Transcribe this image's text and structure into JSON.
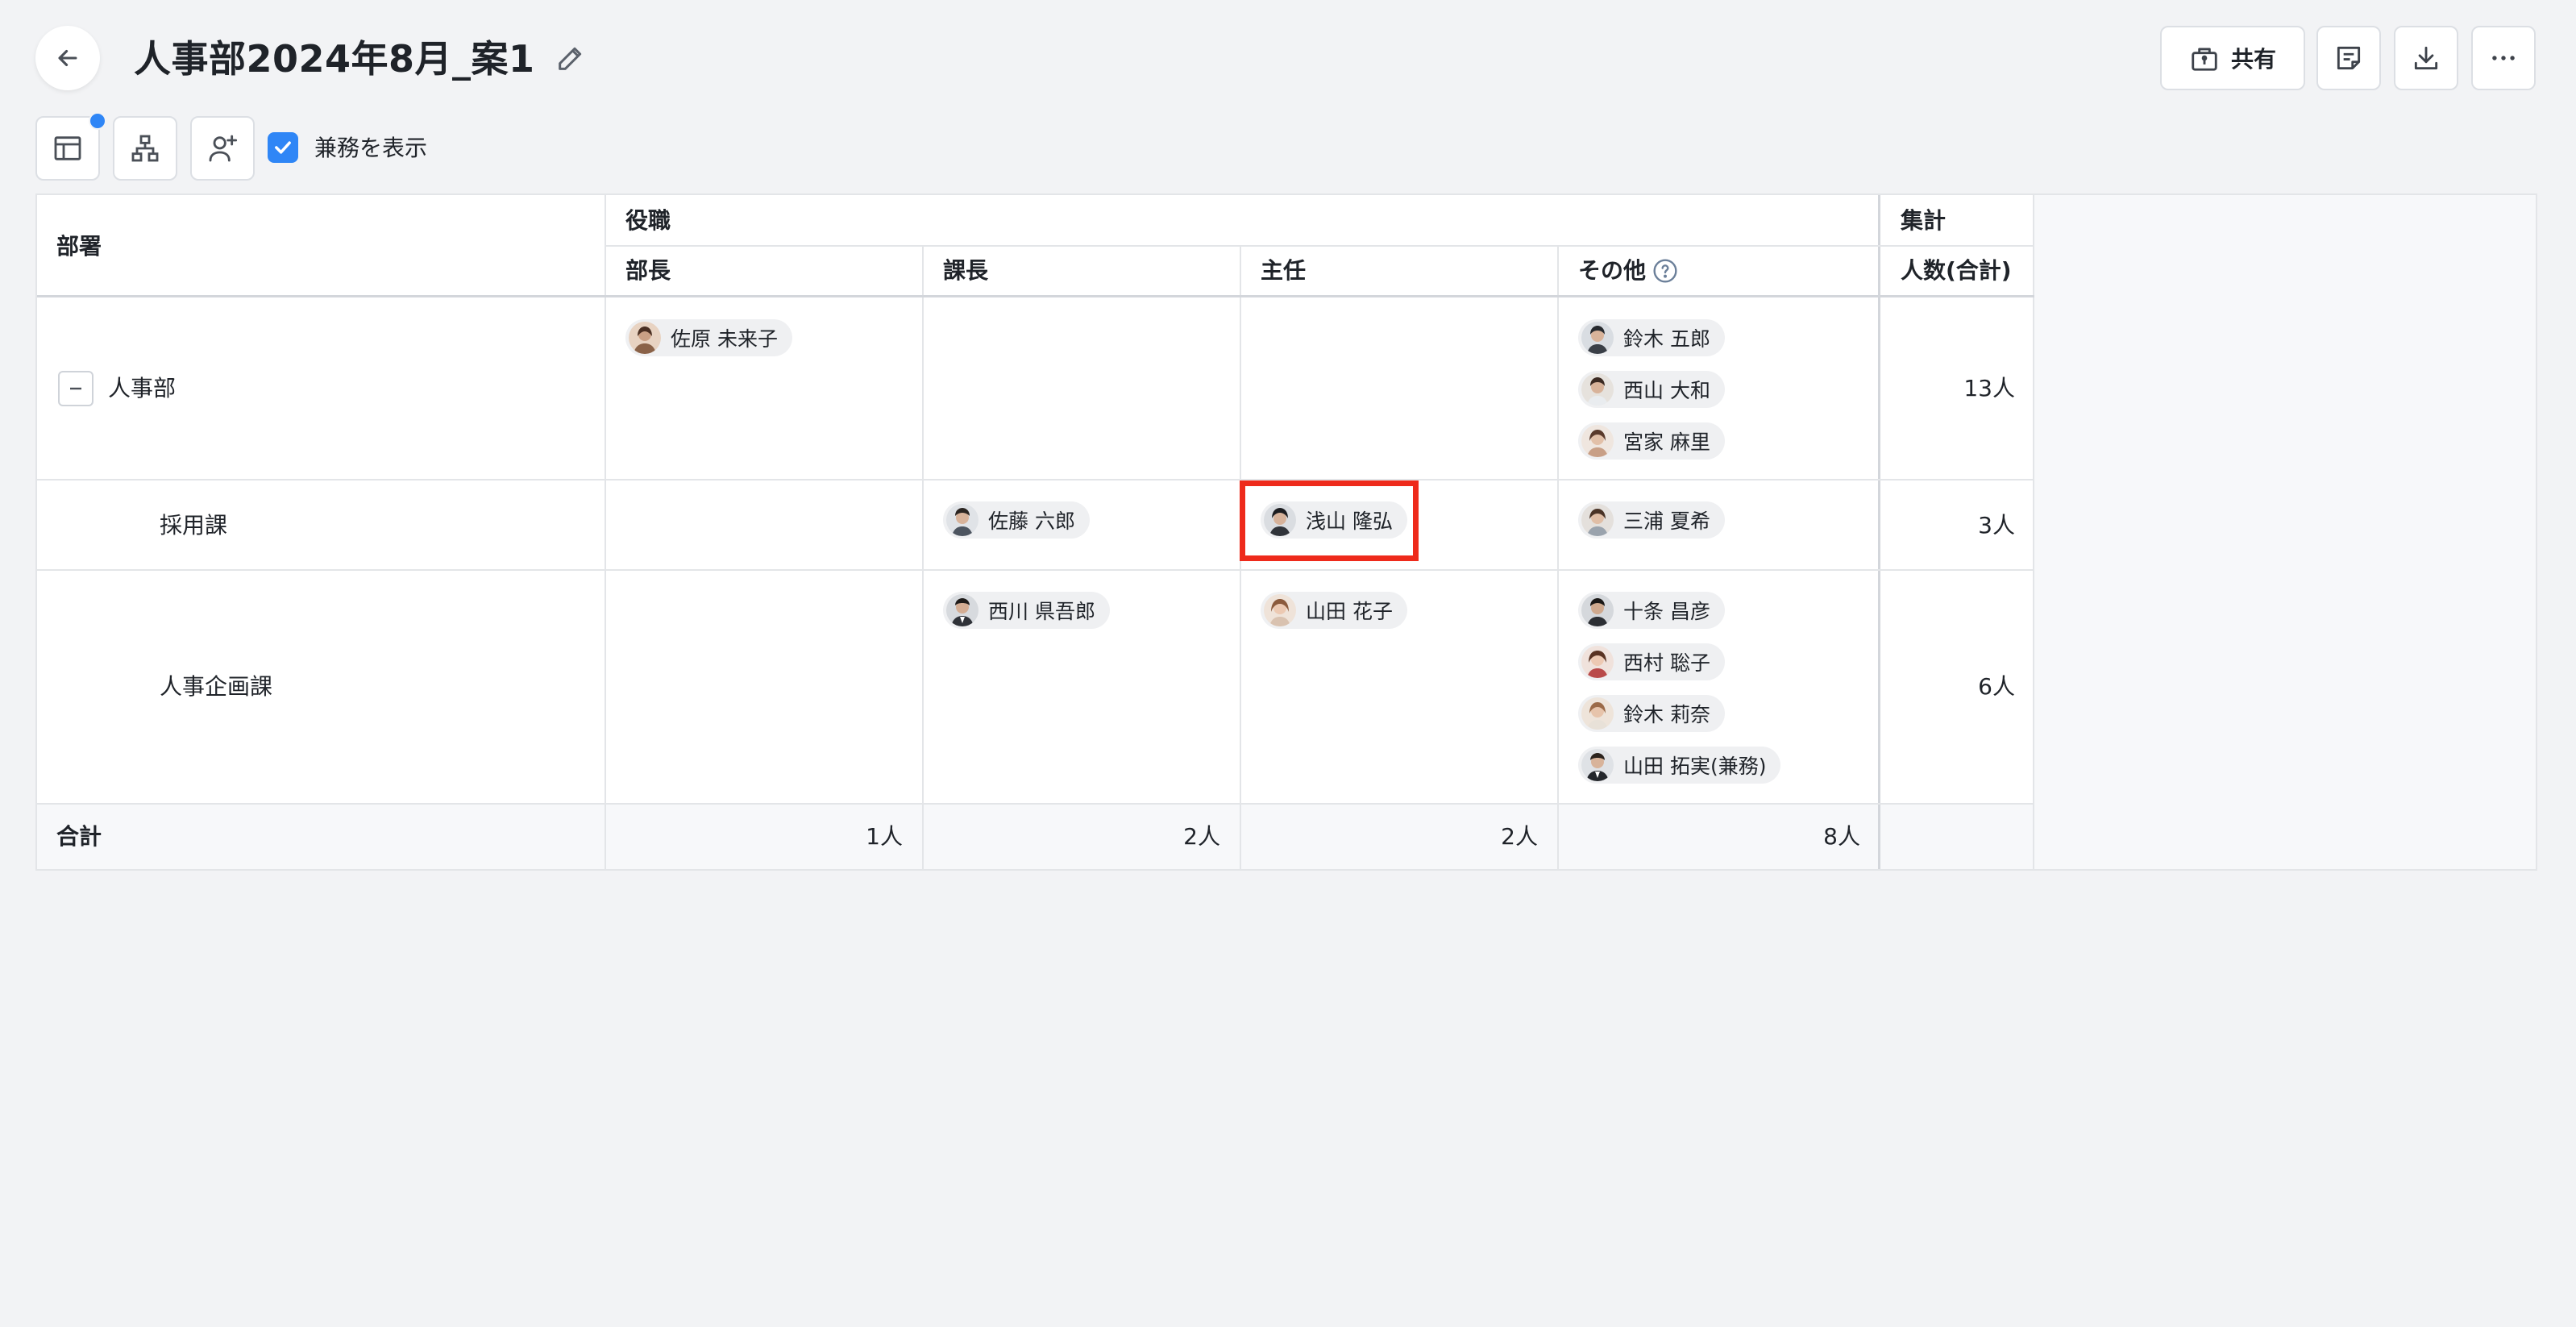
{
  "header": {
    "title": "人事部2024年8月_案1",
    "share_label": "共有"
  },
  "toolbar": {
    "show_concurrent_label": "兼務を表示",
    "show_concurrent_checked": true
  },
  "table": {
    "col_department": "部署",
    "group_positions": "役職",
    "group_summary": "集計",
    "col_bucho": "部長",
    "col_kacho": "課長",
    "col_shunin": "主任",
    "col_other": "その他",
    "col_count": "人数(合計)",
    "rows": [
      {
        "dept": "人事部",
        "bucho": [
          "佐原 未来子"
        ],
        "kacho": [],
        "shunin": [],
        "other": [
          "鈴木 五郎",
          "西山 大和",
          "宮家 麻里"
        ],
        "count": "13人"
      },
      {
        "dept": "採用課",
        "bucho": [],
        "kacho": [
          "佐藤 六郎"
        ],
        "shunin": [
          "浅山 隆弘"
        ],
        "other": [
          "三浦 夏希"
        ],
        "count": "3人"
      },
      {
        "dept": "人事企画課",
        "bucho": [],
        "kacho": [
          "西川 県吾郎"
        ],
        "shunin": [
          "山田 花子"
        ],
        "other": [
          "十条 昌彦",
          "西村 聡子",
          "鈴木 莉奈",
          "山田 拓実(兼務)"
        ],
        "count": "6人"
      }
    ],
    "total_label": "合計",
    "totals": {
      "bucho": "1人",
      "kacho": "2人",
      "shunin": "2人",
      "other": "8人"
    }
  },
  "colors": {
    "accent": "#2f86f6",
    "highlight": "#ee2a1b"
  },
  "icons": {
    "back": "arrow-left-icon",
    "edit": "pencil-icon",
    "share": "share-box-icon",
    "note": "note-icon",
    "download": "download-icon",
    "more": "more-horizontal-icon",
    "table_view": "table-view-icon",
    "org_chart": "org-chart-icon",
    "add_person": "add-person-icon",
    "help": "help-circle-icon",
    "collapse": "minus-icon"
  }
}
